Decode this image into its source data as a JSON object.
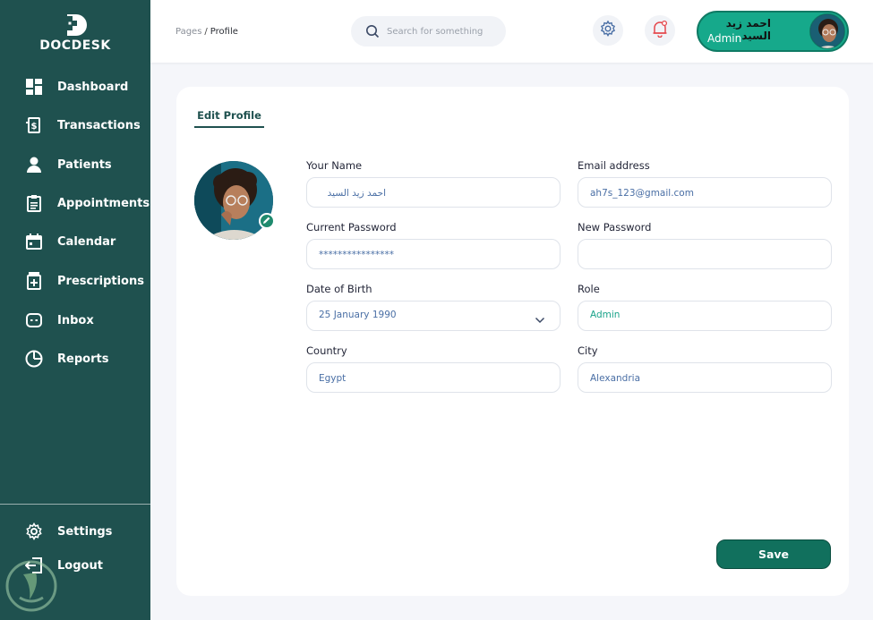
{
  "brand": {
    "name": "DOCDESK"
  },
  "sidebar": {
    "items": [
      {
        "label": "Dashboard",
        "icon": "dashboard-icon"
      },
      {
        "label": "Transactions",
        "icon": "transactions-icon"
      },
      {
        "label": "Patients",
        "icon": "patients-icon"
      },
      {
        "label": "Appointments",
        "icon": "appointments-icon"
      },
      {
        "label": "Calendar",
        "icon": "calendar-icon"
      },
      {
        "label": "Prescriptions",
        "icon": "prescriptions-icon"
      },
      {
        "label": "Inbox",
        "icon": "inbox-icon"
      },
      {
        "label": "Reports",
        "icon": "reports-icon"
      }
    ],
    "bottom": [
      {
        "label": "Settings",
        "icon": "gear-icon"
      },
      {
        "label": "Logout",
        "icon": "logout-icon"
      }
    ]
  },
  "header": {
    "breadcrumb": {
      "parent": "Pages",
      "separator": "/",
      "current": "Profile"
    },
    "search_placeholder": "Search for something",
    "user": {
      "name": "احمد زيد السيد",
      "role": "Admin"
    }
  },
  "profile": {
    "tab": "Edit Profile",
    "fields": {
      "name": {
        "label": "Your Name",
        "value": "احمد زيد السيد"
      },
      "email": {
        "label": "Email address",
        "value": "ah7s_123@gmail.com"
      },
      "current_password": {
        "label": "Current Password",
        "value": "****************"
      },
      "new_password": {
        "label": "New Password",
        "value": ""
      },
      "dob": {
        "label": "Date of Birth",
        "value": "25 January 1990"
      },
      "role": {
        "label": "Role",
        "value": "Admin"
      },
      "country": {
        "label": "Country",
        "value": "Egypt"
      },
      "city": {
        "label": "City",
        "value": "Alexandria"
      }
    },
    "save_label": "Save"
  },
  "colors": {
    "sidebar": "#1f514f",
    "accent": "#16a98b",
    "button": "#11705d",
    "field_text": "#4a6fa5",
    "notification": "#e5484d"
  }
}
